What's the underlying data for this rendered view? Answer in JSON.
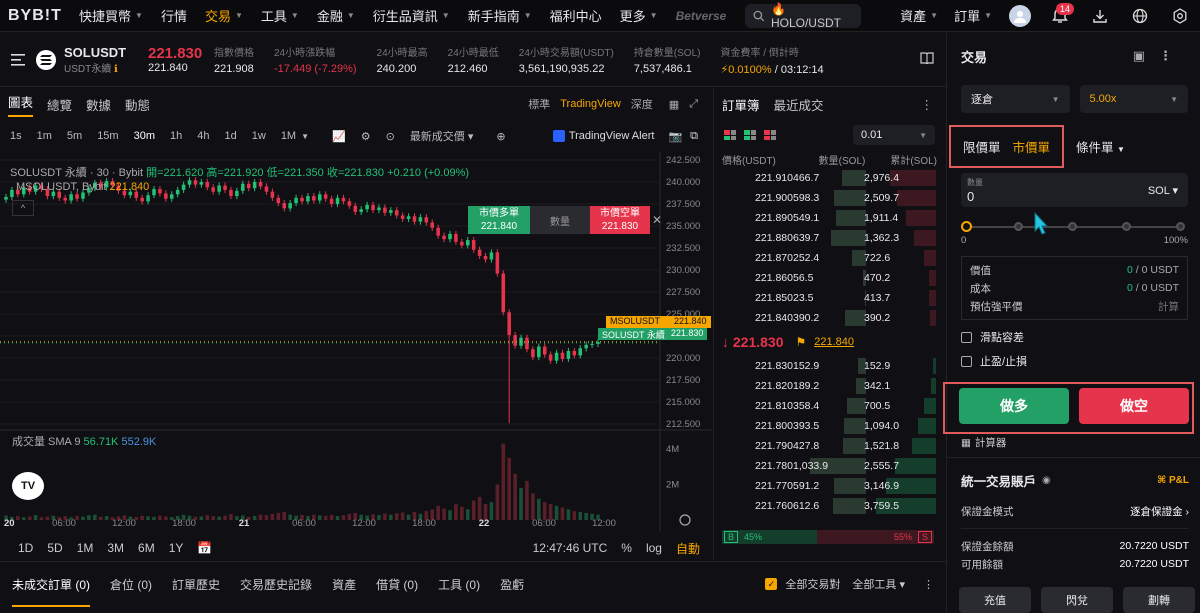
{
  "nav": {
    "logo": "BYB!T",
    "items": [
      {
        "label": "快捷買幣",
        "chev": true
      },
      {
        "label": "行情",
        "chev": false
      },
      {
        "label": "交易",
        "chev": true,
        "active": true
      },
      {
        "label": "工具",
        "chev": true
      },
      {
        "label": "金融",
        "chev": true
      },
      {
        "label": "衍生品資訊",
        "chev": true
      },
      {
        "label": "新手指南",
        "chev": true
      },
      {
        "label": "福利中心",
        "chev": false
      },
      {
        "label": "更多",
        "chev": true
      }
    ],
    "betverse": "Betverse",
    "search_text": "🔥HOLO/USDT",
    "assets": "資產",
    "orders": "訂單",
    "notif_count": "14"
  },
  "ticker": {
    "symbol": "SOLUSDT",
    "sub": "USDT永續",
    "last_price": "221.830",
    "mark_price": "221.840",
    "stats": [
      {
        "label": "指數價格",
        "value": "221.908",
        "color": ""
      },
      {
        "label": "24小時漲跌幅",
        "value": "-17.449 (-7.29%)",
        "color": "red"
      },
      {
        "label": "24小時最高",
        "value": "240.200",
        "color": ""
      },
      {
        "label": "24小時最低",
        "value": "212.460",
        "color": ""
      },
      {
        "label": "24小時交易額(USDT)",
        "value": "3,561,190,935.22",
        "color": ""
      },
      {
        "label": "持倉數量(SOL)",
        "value": "7,537,486.1",
        "color": ""
      },
      {
        "label": "資金費率 / 倒計時",
        "value": "0.0100%",
        "value2": " / 03:12:14",
        "color": "orange"
      }
    ]
  },
  "chart_tabs": {
    "items": [
      "圖表",
      "總覽",
      "數據",
      "動態"
    ],
    "right": [
      "標準",
      "TradingView",
      "深度"
    ]
  },
  "chart_toolbar": {
    "intervals": [
      "1s",
      "1m",
      "5m",
      "15m",
      "30m",
      "1h",
      "4h",
      "1d",
      "1w",
      "1M"
    ],
    "active": "30m",
    "price_type": "最新成交價",
    "alert": "TradingView Alert"
  },
  "chart_legend": {
    "line1_prefix": "SOLUSDT 永續 · 30 · Bybit",
    "line1_values": "開=221.620 高=221.920 低=221.350 收=221.830 +0.210 (+0.09%)",
    "line2_label": "MSOLUSDT, Bybit",
    "line2_value": "221.840",
    "volume_label": "成交量 SMA 9",
    "volume_v1": "56.71K",
    "volume_v2": "552.9K"
  },
  "quick_trade": {
    "buy_label": "市價多單",
    "buy_price": "221.840",
    "qty_label": "數量",
    "sell_label": "市價空單",
    "sell_price": "221.830"
  },
  "price_labels": {
    "mark_name": "MSOLUSDT",
    "mark_price": "221.840",
    "last_name": "SOLUSDT 永續",
    "last_price": "221.830"
  },
  "chart_data": {
    "type": "candlestick",
    "y_ticks": [
      "242.500",
      "240.000",
      "237.500",
      "235.000",
      "232.500",
      "230.000",
      "227.500",
      "225.000",
      "222.500",
      "220.000",
      "217.500",
      "215.000",
      "212.500"
    ],
    "ylim": [
      212.5,
      242.5
    ],
    "vol_ticks": [
      "4M",
      "2M"
    ],
    "x_ticks": [
      "20",
      "06:00",
      "12:00",
      "18:00",
      "21",
      "06:00",
      "12:00",
      "18:00",
      "22",
      "06:00",
      "12:00"
    ],
    "series": [
      {
        "type": "price",
        "values": [
          238.3,
          239.1,
          238.6,
          239.4,
          238.9,
          239.6,
          239.2,
          238.4,
          238.9,
          238.2,
          237.9,
          238.6,
          238.1,
          238.8,
          239.3,
          239.9,
          239.4,
          240.1,
          239.6,
          239.0,
          238.5,
          238.9,
          238.2,
          237.8,
          238.5,
          239.2,
          238.7,
          238.1,
          238.6,
          239.1,
          239.7,
          240.2,
          239.7,
          240.0,
          239.4,
          238.9,
          239.6,
          239.1,
          238.4,
          239.0,
          239.8,
          239.3,
          240.0,
          239.5,
          238.9,
          238.2,
          237.6,
          237.0,
          237.6,
          238.2,
          237.8,
          238.4,
          237.9,
          238.6,
          238.1,
          237.5,
          238.2,
          237.8,
          237.3,
          236.6,
          236.9,
          237.4,
          236.8,
          237.1,
          236.5,
          236.8,
          236.2,
          235.8,
          236.1,
          235.5,
          236.0,
          235.4,
          234.8,
          233.9,
          233.5,
          234.1,
          233.2,
          232.8,
          233.4,
          232.3,
          231.6,
          231.2,
          232.0,
          229.6,
          225.2,
          222.6,
          221.4,
          222.3,
          221.0,
          220.1,
          221.3,
          220.4,
          219.7,
          220.6,
          219.9,
          220.8,
          220.3,
          221.1,
          221.5,
          221.6,
          221.8
        ]
      },
      {
        "type": "volume",
        "values": [
          0.25,
          0.18,
          0.22,
          0.15,
          0.2,
          0.28,
          0.16,
          0.19,
          0.24,
          0.17,
          0.21,
          0.15,
          0.23,
          0.19,
          0.27,
          0.3,
          0.18,
          0.22,
          0.16,
          0.2,
          0.26,
          0.19,
          0.17,
          0.23,
          0.21,
          0.18,
          0.25,
          0.2,
          0.16,
          0.22,
          0.29,
          0.24,
          0.18,
          0.2,
          0.27,
          0.22,
          0.19,
          0.24,
          0.33,
          0.21,
          0.26,
          0.18,
          0.23,
          0.3,
          0.27,
          0.35,
          0.4,
          0.45,
          0.3,
          0.25,
          0.28,
          0.22,
          0.3,
          0.26,
          0.24,
          0.29,
          0.22,
          0.27,
          0.35,
          0.4,
          0.3,
          0.25,
          0.32,
          0.28,
          0.36,
          0.3,
          0.38,
          0.42,
          0.3,
          0.45,
          0.35,
          0.5,
          0.6,
          0.8,
          0.65,
          0.55,
          0.9,
          0.75,
          0.6,
          1.1,
          1.3,
          0.9,
          1.0,
          2.0,
          4.3,
          3.5,
          2.6,
          1.8,
          2.2,
          1.5,
          1.2,
          1.0,
          0.9,
          0.8,
          0.7,
          0.6,
          0.5,
          0.45,
          0.4,
          0.35,
          0.3
        ]
      }
    ]
  },
  "chart_bottom": {
    "ranges": [
      "1D",
      "5D",
      "1M",
      "3M",
      "6M",
      "1Y"
    ],
    "time": "12:47:46 UTC",
    "pct": "%",
    "log": "log",
    "auto": "自動"
  },
  "orderbook": {
    "tabs": [
      "訂單簿",
      "最近成交"
    ],
    "precision": "0.01",
    "headers": [
      "價格(USDT)",
      "數量(SOL)",
      "累計(SOL)"
    ],
    "asks": [
      {
        "price": "221.910",
        "qty": "466.7",
        "total": "2,976.4",
        "qf": 0.34,
        "tf": 0.68
      },
      {
        "price": "221.900",
        "qty": "598.3",
        "total": "2,509.7",
        "qf": 0.45,
        "tf": 0.58
      },
      {
        "price": "221.890",
        "qty": "549.1",
        "total": "1,911.4",
        "qf": 0.41,
        "tf": 0.44
      },
      {
        "price": "221.880",
        "qty": "639.7",
        "total": "1,362.3",
        "qf": 0.48,
        "tf": 0.32
      },
      {
        "price": "221.870",
        "qty": "252.4",
        "total": "722.6",
        "qf": 0.19,
        "tf": 0.17
      },
      {
        "price": "221.860",
        "qty": "56.5",
        "total": "470.2",
        "qf": 0.04,
        "tf": 0.11
      },
      {
        "price": "221.850",
        "qty": "23.5",
        "total": "413.7",
        "qf": 0.02,
        "tf": 0.1
      },
      {
        "price": "221.840",
        "qty": "390.2",
        "total": "390.2",
        "qf": 0.29,
        "tf": 0.09
      }
    ],
    "mid_price": "221.830",
    "mark": "221.840",
    "bids": [
      {
        "price": "221.830",
        "qty": "152.9",
        "total": "152.9",
        "qf": 0.11,
        "tf": 0.04
      },
      {
        "price": "221.820",
        "qty": "189.2",
        "total": "342.1",
        "qf": 0.14,
        "tf": 0.08
      },
      {
        "price": "221.810",
        "qty": "358.4",
        "total": "700.5",
        "qf": 0.27,
        "tf": 0.17
      },
      {
        "price": "221.800",
        "qty": "393.5",
        "total": "1,094.0",
        "qf": 0.3,
        "tf": 0.26
      },
      {
        "price": "221.790",
        "qty": "427.8",
        "total": "1,521.8",
        "qf": 0.32,
        "tf": 0.36
      },
      {
        "price": "221.780",
        "qty": "1,033.9",
        "total": "2,555.7",
        "qf": 0.78,
        "tf": 0.6
      },
      {
        "price": "221.770",
        "qty": "591.2",
        "total": "3,146.9",
        "qf": 0.45,
        "tf": 0.74
      },
      {
        "price": "221.760",
        "qty": "612.6",
        "total": "3,759.5",
        "qf": 0.46,
        "tf": 0.88
      }
    ],
    "buy_pct": "45%",
    "sell_pct": "55%",
    "buy_fraction": 0.45,
    "buy_tag": "B",
    "sell_tag": "S"
  },
  "trade": {
    "title": "交易",
    "margin_mode": "逐倉",
    "leverage": "5.00x",
    "order_types": [
      "限價單",
      "市價單",
      "條件單"
    ],
    "active_order_type": "市價單",
    "qty_label": "數量",
    "qty_value": "0",
    "qty_unit": "SOL",
    "slider_min": "0%",
    "slider_max": "100%",
    "slider_min_label": "0",
    "info": [
      {
        "label": "價值",
        "v1": "0",
        "v2": "0 USDT"
      },
      {
        "label": "成本",
        "v1": "0",
        "v2": "0 USDT"
      },
      {
        "label": "預估強平價",
        "v1": "",
        "v2": "計算"
      }
    ],
    "slippage": "滑點容差",
    "tpsl": "止盈/止損",
    "long_btn": "做多",
    "short_btn": "做空",
    "calculator": "計算器"
  },
  "account": {
    "title": "統一交易賬戶",
    "pl": "P&L",
    "margin_mode_label": "保證金模式",
    "margin_mode_value": "逐倉保證金",
    "balance_label": "保證金餘額",
    "balance_value": "20.7220 USDT",
    "available_label": "可用餘額",
    "available_value": "20.7220 USDT",
    "buttons": [
      "充值",
      "閃兌",
      "劃轉"
    ]
  },
  "bottom_tabs": {
    "items": [
      "未成交訂單 (0)",
      "倉位 (0)",
      "訂單歷史",
      "交易歷史記錄",
      "資產",
      "借貸 (0)",
      "工具 (0)",
      "盈虧"
    ],
    "all_pairs": "全部交易對",
    "all_tools": "全部工具"
  },
  "colors": {
    "accent": "#f7a600",
    "up": "#22c176",
    "down": "#e5344b"
  }
}
